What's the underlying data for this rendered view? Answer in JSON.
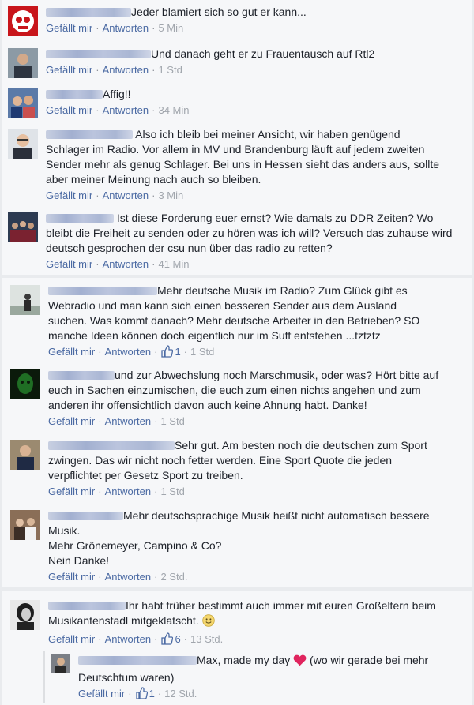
{
  "labels": {
    "like": "Gefällt mir",
    "reply": "Antworten",
    "sep": "·"
  },
  "comments": [
    {
      "text": "Jeder blamiert sich so gut er kann...",
      "time": "5 Min",
      "avatar_icon": "skull-logo-icon"
    },
    {
      "text": "Und danach geht er zu Frauentausch auf Rtl2",
      "time": "1 Std",
      "avatar_icon": "man-photo-icon"
    },
    {
      "text": "Affig!!",
      "time": "34 Min",
      "avatar_icon": "group-photo-icon"
    },
    {
      "text": "Also ich bleib bei meiner Ansicht, wir haben genügend Schlager im Radio. Vor allem in MV und Brandenburg läuft auf jedem zweiten Sender mehr als genug Schlager. Bei uns in Hessen sieht das anders aus, sollte aber meiner Meinung nach auch so bleiben.",
      "time": "3 Min",
      "avatar_icon": "man-glasses-photo-icon"
    },
    {
      "text": "Ist diese Forderung euer ernst? Wie damals zu DDR Zeiten? Wo bleibt die Freiheit zu senden oder zu hören was ich will? Versuch das zuhause wird deutsch gesprochen der csu nun über das radio zu retten?",
      "time": "41 Min",
      "avatar_icon": "crowd-photo-icon"
    },
    {
      "text": "Mehr deutsche Musik im Radio? Zum Glück gibt es Webradio und man kann sich einen besseren Sender aus dem Ausland suchen. Was kommt danach? Mehr deutsche Arbeiter in den Betrieben? SO manche Ideen können doch eigentlich nur im Suff entstehen ...tztztz",
      "time": "1 Std",
      "likes": "1",
      "avatar_icon": "person-snow-photo-icon"
    },
    {
      "text": "und zur Abwechslung noch Marschmusik, oder was? Hört bitte auf euch in Sachen einzumischen, die euch zum einen nichts angehen und zum anderen ihr offensichtlich davon auch keine Ahnung habt. Danke!",
      "time": "1 Std",
      "avatar_icon": "green-face-photo-icon"
    },
    {
      "text": "Sehr gut. Am besten noch die deutschen zum Sport zwingen. Das wir nicht noch fetter werden. Eine Sport Quote die jeden verpflichtet per Gesetz Sport zu treiben.",
      "time": "1 Std",
      "avatar_icon": "man-suit-photo-icon"
    },
    {
      "text": "Mehr deutschsprachige Musik heißt nicht automatisch bessere Musik.",
      "text2": "Mehr Grönemeyer, Campino & Co?",
      "text3": "Nein Danke!",
      "time": "2 Std.",
      "avatar_icon": "people-indoor-photo-icon"
    },
    {
      "text": "Ihr habt früher bestimmt auch immer mit euren Großeltern beim Musikantenstadl mitgeklatscht.",
      "time": "13 Std.",
      "likes": "6",
      "avatar_icon": "dark-hair-photo-icon",
      "emoji": "smile-emoji-icon"
    },
    {
      "text": "Max, made my day",
      "text_after": "(wo wir gerade bei mehr Deutschtum waren)",
      "time": "12 Std.",
      "likes": "1",
      "avatar_icon": "small-man-photo-icon",
      "emoji": "heart-icon"
    }
  ],
  "colors": {
    "link": "#4b6aa3",
    "meta": "#90949c",
    "text": "#1d2129",
    "heart": "#e0245e"
  }
}
